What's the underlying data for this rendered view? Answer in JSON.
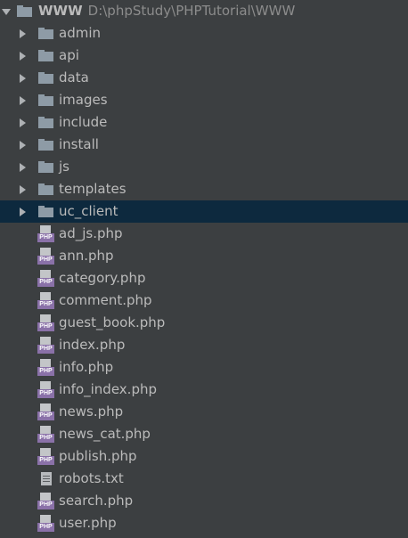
{
  "root": {
    "name": "WWW",
    "path": "D:\\phpStudy\\PHPTutorial\\WWW"
  },
  "folders": [
    {
      "label": "admin"
    },
    {
      "label": "api"
    },
    {
      "label": "data"
    },
    {
      "label": "images"
    },
    {
      "label": "include"
    },
    {
      "label": "install"
    },
    {
      "label": "js"
    },
    {
      "label": "templates"
    },
    {
      "label": "uc_client",
      "selected": true
    }
  ],
  "files": [
    {
      "label": "ad_js.php",
      "type": "php"
    },
    {
      "label": "ann.php",
      "type": "php"
    },
    {
      "label": "category.php",
      "type": "php"
    },
    {
      "label": "comment.php",
      "type": "php"
    },
    {
      "label": "guest_book.php",
      "type": "php"
    },
    {
      "label": "index.php",
      "type": "php"
    },
    {
      "label": "info.php",
      "type": "php"
    },
    {
      "label": "info_index.php",
      "type": "php"
    },
    {
      "label": "news.php",
      "type": "php"
    },
    {
      "label": "news_cat.php",
      "type": "php"
    },
    {
      "label": "publish.php",
      "type": "php"
    },
    {
      "label": "robots.txt",
      "type": "txt"
    },
    {
      "label": "search.php",
      "type": "php"
    },
    {
      "label": "user.php",
      "type": "php"
    }
  ],
  "php_badge_text": "PHP",
  "colors": {
    "background": "#3c3f41",
    "selection": "#0d293e",
    "folder_icon": "#8e9ba6",
    "php_badge": "#8a71a8",
    "text": "#bbbbbb",
    "path_text": "#8c8c8c"
  },
  "icons": {
    "expanded": "chevron-down-icon",
    "collapsed": "chevron-right-icon",
    "folder": "folder-icon",
    "php_file": "php-file-icon",
    "text_file": "text-file-icon"
  }
}
